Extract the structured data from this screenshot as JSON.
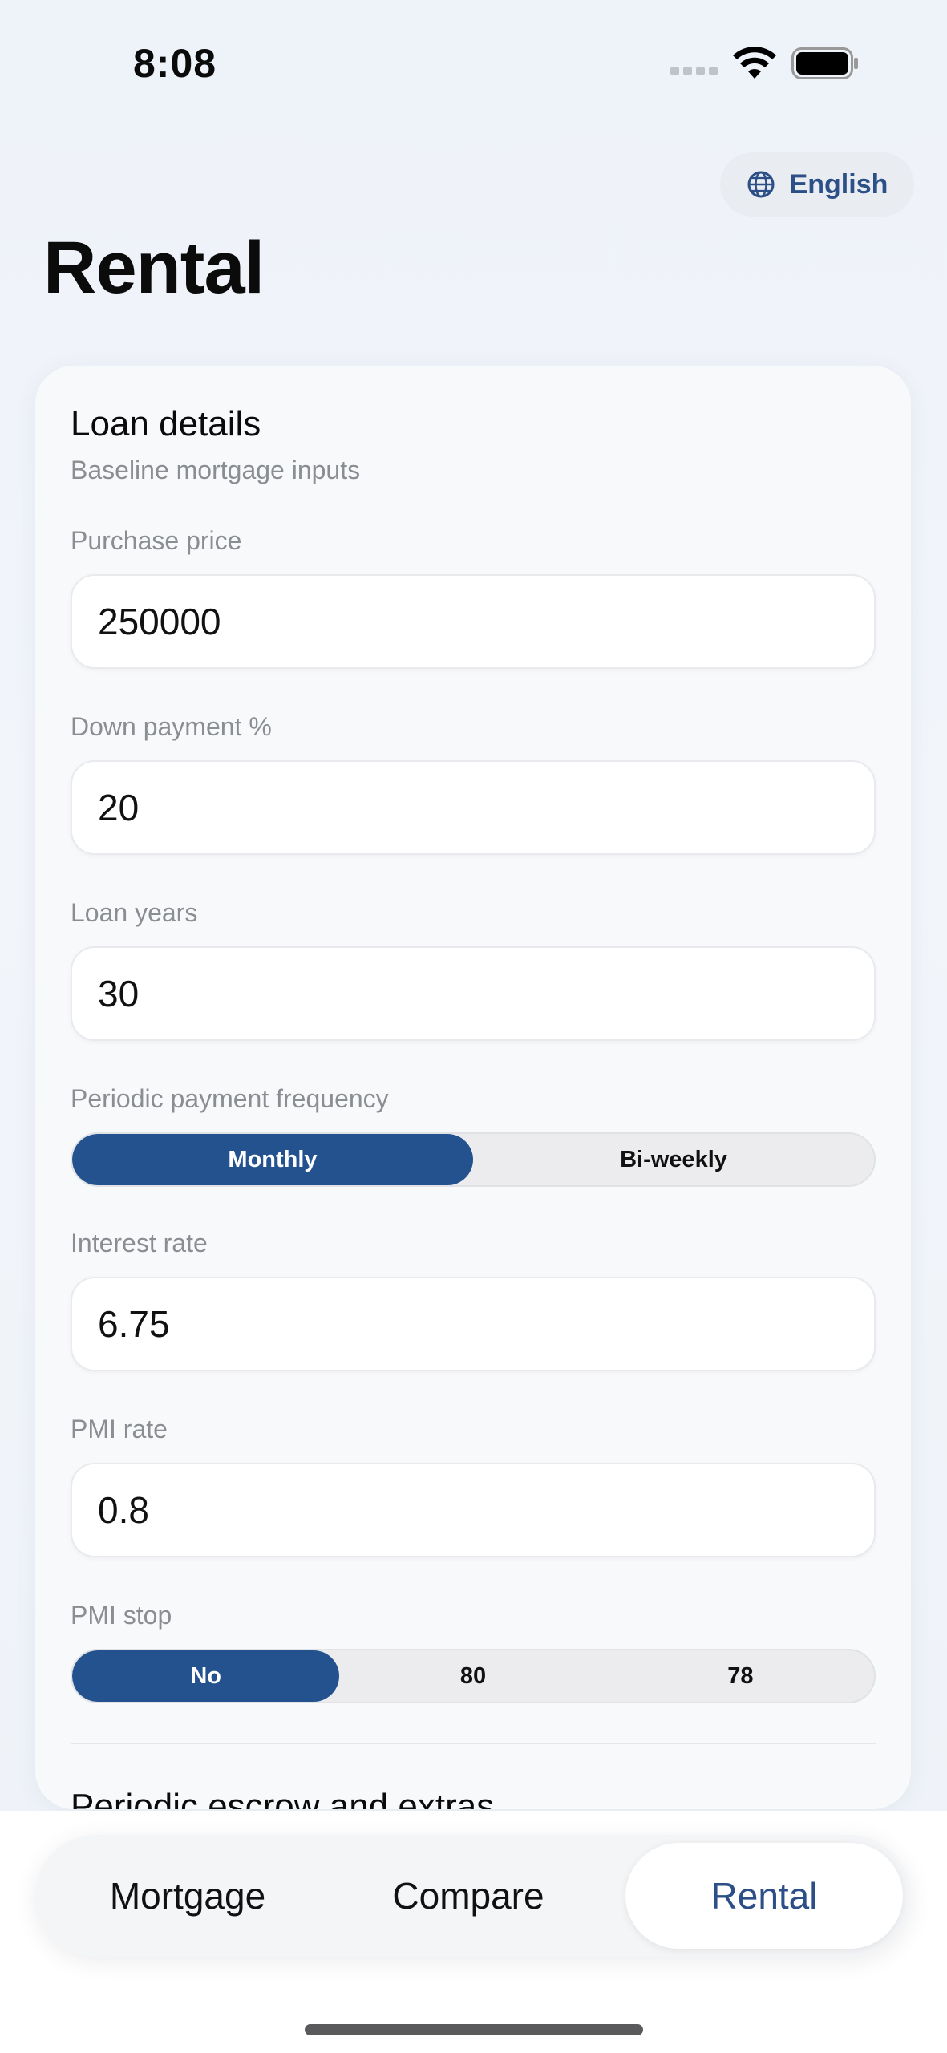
{
  "status_bar": {
    "time": "8:08"
  },
  "language": {
    "label": "English",
    "icon": "globe-icon"
  },
  "page": {
    "title": "Rental"
  },
  "loan_details": {
    "title": "Loan details",
    "subtitle": "Baseline mortgage inputs",
    "purchase_price": {
      "label": "Purchase price",
      "value": "250000"
    },
    "down_payment": {
      "label": "Down payment %",
      "value": "20"
    },
    "loan_years": {
      "label": "Loan years",
      "value": "30"
    },
    "frequency": {
      "label": "Periodic payment frequency",
      "options": [
        "Monthly",
        "Bi-weekly"
      ],
      "selected": "Monthly"
    },
    "interest_rate": {
      "label": "Interest rate",
      "value": "6.75"
    },
    "pmi_rate": {
      "label": "PMI rate",
      "value": "0.8"
    },
    "pmi_stop": {
      "label": "PMI stop",
      "options": [
        "No",
        "80",
        "78"
      ],
      "selected": "No"
    }
  },
  "next_section": {
    "title": "Periodic escrow and extras"
  },
  "tabs": [
    {
      "label": "Mortgage"
    },
    {
      "label": "Compare"
    },
    {
      "label": "Rental",
      "active": true
    }
  ],
  "colors": {
    "accent": "#24528f",
    "accent_text": "#2b4f86"
  }
}
